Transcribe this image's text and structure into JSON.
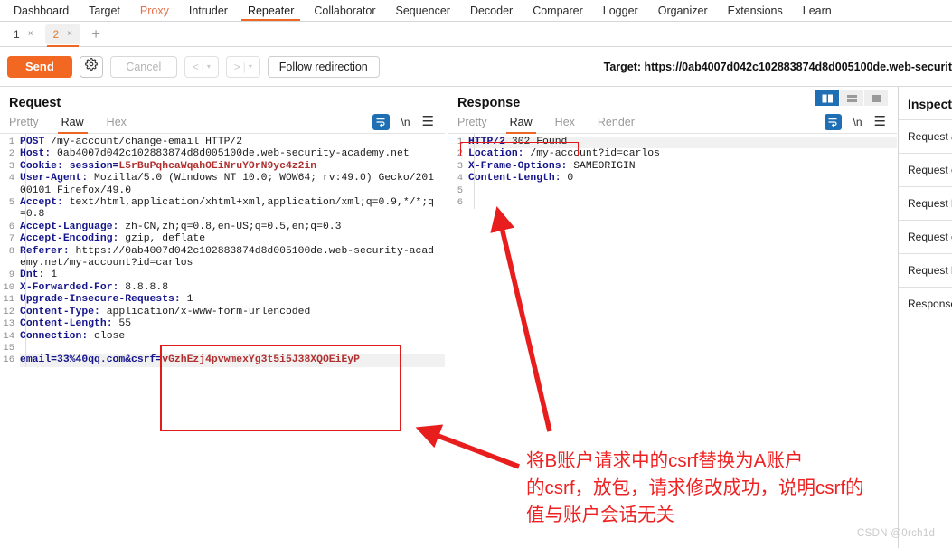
{
  "main_tabs": [
    {
      "label": "Dashboard",
      "state": "normal"
    },
    {
      "label": "Target",
      "state": "normal"
    },
    {
      "label": "Proxy",
      "state": "highlight"
    },
    {
      "label": "Intruder",
      "state": "normal"
    },
    {
      "label": "Repeater",
      "state": "active"
    },
    {
      "label": "Collaborator",
      "state": "normal"
    },
    {
      "label": "Sequencer",
      "state": "normal"
    },
    {
      "label": "Decoder",
      "state": "normal"
    },
    {
      "label": "Comparer",
      "state": "normal"
    },
    {
      "label": "Logger",
      "state": "normal"
    },
    {
      "label": "Organizer",
      "state": "normal"
    },
    {
      "label": "Extensions",
      "state": "normal"
    },
    {
      "label": "Learn",
      "state": "normal"
    }
  ],
  "sub_tabs": [
    {
      "label": "1",
      "close": "×",
      "active": false
    },
    {
      "label": "2",
      "close": "×",
      "active": true
    }
  ],
  "add_tab_label": "+",
  "toolbar": {
    "send_label": "Send",
    "cancel_label": "Cancel",
    "prev_label": "<",
    "next_label": ">",
    "caret": "▾",
    "separator": "|",
    "follow_redirection_label": "Follow redirection",
    "target_label": "Target: https://0ab4007d042c102883874d8d005100de.web-securit"
  },
  "request": {
    "title": "Request",
    "formats": [
      {
        "label": "Pretty",
        "active": false
      },
      {
        "label": "Raw",
        "active": true
      },
      {
        "label": "Hex",
        "active": false
      }
    ],
    "newline_icon_label": "\\n",
    "lines": [
      {
        "num": "1",
        "kw": "POST",
        "sep": " ",
        "val": "/my-account/change-email HTTP/2",
        "style": "plain"
      },
      {
        "num": "2",
        "kw": "Host:",
        "sep": " ",
        "val": "0ab4007d042c102883874d8d005100de.web-security-academy.net",
        "style": "header"
      },
      {
        "num": "3",
        "kw": "Cookie:",
        "sep": " ",
        "val": "session=",
        "red": "L5rBuPqhcaWqahOEiNruYOrN9yc4z2in",
        "style": "cookie"
      },
      {
        "num": "4",
        "kw": "User-Agent:",
        "sep": " ",
        "val": "Mozilla/5.0 (Windows NT 10.0; WOW64; rv:49.0) Gecko/20100101 Firefox/49.0",
        "style": "header"
      },
      {
        "num": "5",
        "kw": "Accept:",
        "sep": " ",
        "val": "text/html,application/xhtml+xml,application/xml;q=0.9,*/*;q=0.8",
        "style": "header"
      },
      {
        "num": "6",
        "kw": "Accept-Language:",
        "sep": " ",
        "val": "zh-CN,zh;q=0.8,en-US;q=0.5,en;q=0.3",
        "style": "header"
      },
      {
        "num": "7",
        "kw": "Accept-Encoding:",
        "sep": " ",
        "val": "gzip, deflate",
        "style": "header"
      },
      {
        "num": "8",
        "kw": "Referer:",
        "sep": " ",
        "val": "https://0ab4007d042c102883874d8d005100de.web-security-academy.net/my-account?id=carlos",
        "style": "header"
      },
      {
        "num": "9",
        "kw": "Dnt:",
        "sep": " ",
        "val": "1",
        "style": "header"
      },
      {
        "num": "10",
        "kw": "X-Forwarded-For:",
        "sep": " ",
        "val": "8.8.8.8",
        "style": "header"
      },
      {
        "num": "11",
        "kw": "Upgrade-Insecure-Requests:",
        "sep": " ",
        "val": "1",
        "style": "header"
      },
      {
        "num": "12",
        "kw": "Content-Type:",
        "sep": " ",
        "val": "application/x-www-form-urlencoded",
        "style": "header"
      },
      {
        "num": "13",
        "kw": "Content-Length:",
        "sep": " ",
        "val": "55",
        "style": "header"
      },
      {
        "num": "14",
        "kw": "Connection:",
        "sep": " ",
        "val": "close",
        "style": "header"
      },
      {
        "num": "15",
        "kw": "",
        "sep": "",
        "val": "",
        "style": "blank"
      },
      {
        "num": "16",
        "kw": "email=",
        "sep": "",
        "val": "33%40qq.com",
        "mid": "&csrf=",
        "red": "vGzhEzj4pvwmexYg3t5i5J38XQOEiEyP",
        "style": "body"
      }
    ]
  },
  "response": {
    "title": "Response",
    "formats": [
      {
        "label": "Pretty",
        "active": false
      },
      {
        "label": "Raw",
        "active": true
      },
      {
        "label": "Hex",
        "active": false
      },
      {
        "label": "Render",
        "active": false
      }
    ],
    "newline_icon_label": "\\n",
    "layout_buttons": [
      {
        "name": "side-by-side",
        "active": true
      },
      {
        "name": "stacked",
        "active": false
      },
      {
        "name": "single",
        "active": false
      }
    ],
    "lines": [
      {
        "num": "1",
        "kw": "HTTP/2",
        "sep": " ",
        "val": "302 Found",
        "style": "status"
      },
      {
        "num": "2",
        "kw": "Location:",
        "sep": " ",
        "val": "/my-account?id=carlos",
        "style": "header"
      },
      {
        "num": "3",
        "kw": "X-Frame-Options:",
        "sep": " ",
        "val": "SAMEORIGIN",
        "style": "header"
      },
      {
        "num": "4",
        "kw": "Content-Length:",
        "sep": " ",
        "val": "0",
        "style": "header"
      },
      {
        "num": "5",
        "kw": "",
        "sep": "",
        "val": "",
        "style": "blank"
      },
      {
        "num": "6",
        "kw": "",
        "sep": "",
        "val": "",
        "style": "blank"
      }
    ]
  },
  "inspector": {
    "title": "Inspect",
    "items": [
      {
        "label": "Request a"
      },
      {
        "label": "Request c"
      },
      {
        "label": "Request h"
      },
      {
        "label": "Request c"
      },
      {
        "label": "Request b"
      },
      {
        "label": "Response"
      }
    ]
  },
  "annotation": {
    "text_lines": [
      "将B账户请求中的csrf替换为A账户",
      "的csrf，放包，请求修改成功，说明csrf的",
      "值与账户会话无关"
    ],
    "color": "#ee2222"
  },
  "watermark": "CSDN @0rch1d",
  "colors": {
    "accent_orange": "#ec6723",
    "send_orange": "#f26722",
    "annotation_red": "#e01b1b",
    "blue_icon": "#1f6fb5",
    "header_key_blue": "#15158c",
    "value_red": "#b03030"
  }
}
